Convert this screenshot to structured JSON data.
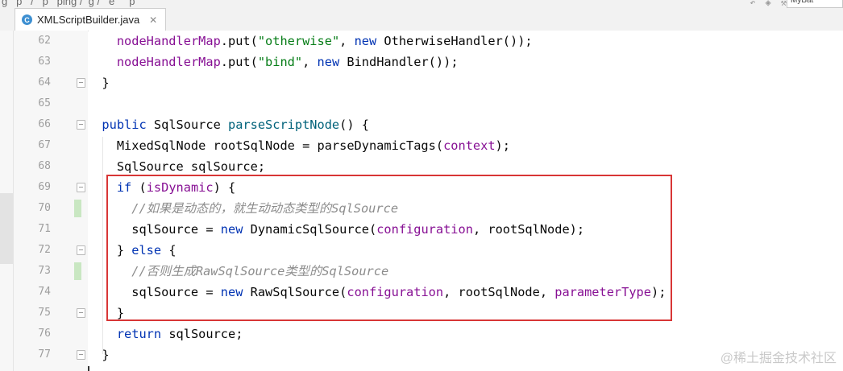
{
  "breadcrumbs": [
    "g",
    "p",
    "/",
    "p",
    "ping",
    "/",
    "g",
    "/",
    "e",
    "p"
  ],
  "tab": {
    "icon_letter": "C",
    "label": "XMLScriptBuilder.java"
  },
  "run_config": "MyBat",
  "code_lines": [
    {
      "num": "62",
      "tokens": [
        {
          "t": "    "
        },
        {
          "t": "nodeHandlerMap",
          "c": "fld"
        },
        {
          "t": ".put("
        },
        {
          "t": "\"otherwise\"",
          "c": "str"
        },
        {
          "t": ", "
        },
        {
          "t": "new",
          "c": "kw"
        },
        {
          "t": " OtherwiseHandler());"
        }
      ]
    },
    {
      "num": "63",
      "tokens": [
        {
          "t": "    "
        },
        {
          "t": "nodeHandlerMap",
          "c": "fld"
        },
        {
          "t": ".put("
        },
        {
          "t": "\"bind\"",
          "c": "str"
        },
        {
          "t": ", "
        },
        {
          "t": "new",
          "c": "kw"
        },
        {
          "t": " BindHandler());"
        }
      ]
    },
    {
      "num": "64",
      "fold": true,
      "tokens": [
        {
          "t": "  }"
        }
      ]
    },
    {
      "num": "65",
      "tokens": []
    },
    {
      "num": "66",
      "fold": true,
      "tokens": [
        {
          "t": "  "
        },
        {
          "t": "public",
          "c": "kw"
        },
        {
          "t": " SqlSource "
        },
        {
          "t": "parseScriptNode",
          "c": "mth"
        },
        {
          "t": "() {"
        }
      ]
    },
    {
      "num": "67",
      "tokens": [
        {
          "t": "    MixedSqlNode rootSqlNode = parseDynamicTags("
        },
        {
          "t": "context",
          "c": "fld"
        },
        {
          "t": ");"
        }
      ]
    },
    {
      "num": "68",
      "tokens": [
        {
          "t": "    SqlSource sqlSource;"
        }
      ]
    },
    {
      "num": "69",
      "fold": true,
      "tokens": [
        {
          "t": "    "
        },
        {
          "t": "if",
          "c": "kw"
        },
        {
          "t": " ("
        },
        {
          "t": "isDynamic",
          "c": "fld"
        },
        {
          "t": ") {"
        }
      ]
    },
    {
      "num": "70",
      "changed": true,
      "tokens": [
        {
          "t": "      "
        },
        {
          "t": "//如果是动态的，就生动动态类型的SqlSource",
          "c": "cmt"
        }
      ]
    },
    {
      "num": "71",
      "tokens": [
        {
          "t": "      sqlSource = "
        },
        {
          "t": "new",
          "c": "kw"
        },
        {
          "t": " DynamicSqlSource("
        },
        {
          "t": "configuration",
          "c": "fld"
        },
        {
          "t": ", rootSqlNode);"
        }
      ]
    },
    {
      "num": "72",
      "fold": true,
      "tokens": [
        {
          "t": "    } "
        },
        {
          "t": "else",
          "c": "kw"
        },
        {
          "t": " {"
        }
      ]
    },
    {
      "num": "73",
      "changed": true,
      "tokens": [
        {
          "t": "      "
        },
        {
          "t": "//否则生成RawSqlSource类型的SqlSource",
          "c": "cmt"
        }
      ]
    },
    {
      "num": "74",
      "tokens": [
        {
          "t": "      sqlSource = "
        },
        {
          "t": "new",
          "c": "kw"
        },
        {
          "t": " RawSqlSource("
        },
        {
          "t": "configuration",
          "c": "fld"
        },
        {
          "t": ", rootSqlNode, "
        },
        {
          "t": "parameterType",
          "c": "fld"
        },
        {
          "t": ");"
        }
      ]
    },
    {
      "num": "75",
      "fold": true,
      "tokens": [
        {
          "t": "    }"
        }
      ]
    },
    {
      "num": "76",
      "tokens": [
        {
          "t": "    "
        },
        {
          "t": "return",
          "c": "kw"
        },
        {
          "t": " sqlSource;"
        }
      ]
    },
    {
      "num": "77",
      "fold": true,
      "tokens": [
        {
          "t": "  }"
        }
      ]
    }
  ],
  "watermark": "@稀土掘金技术社区",
  "colors": {
    "keyword": "#0033b3",
    "string": "#067d17",
    "field": "#871094",
    "method": "#00627a",
    "comment": "#8c8c8c",
    "highlight_box": "#d83636"
  }
}
